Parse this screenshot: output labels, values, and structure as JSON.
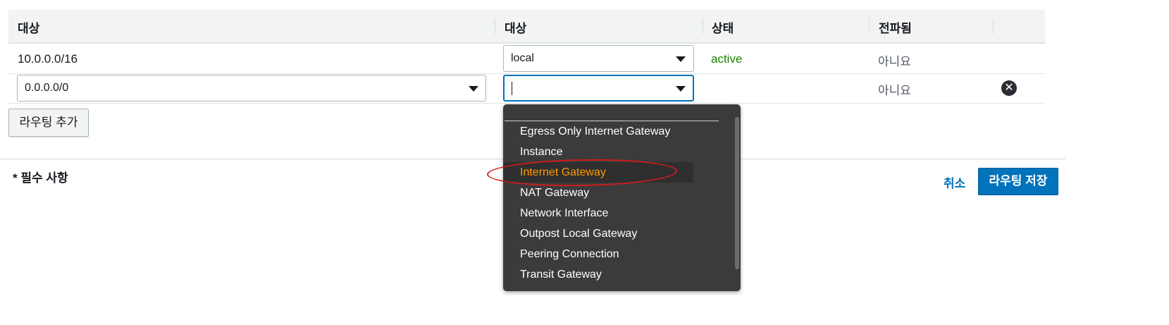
{
  "table": {
    "headers": [
      "대상",
      "대상",
      "상태",
      "전파됨"
    ],
    "rows": [
      {
        "destination": "10.0.0.0/16",
        "target": "local",
        "status": "active",
        "propagated": "아니요"
      },
      {
        "destination": "0.0.0.0/0",
        "target": "",
        "status": "",
        "propagated": "아니요"
      }
    ]
  },
  "actions": {
    "add_route": "라우팅 추가",
    "required_note": "* 필수 사항",
    "cancel": "취소",
    "save": "라우팅 저장"
  },
  "dropdown": {
    "highlighted": "Internet Gateway",
    "options": [
      "Egress Only Internet Gateway",
      "Instance",
      "Internet Gateway",
      "NAT Gateway",
      "Network Interface",
      "Outpost Local Gateway",
      "Peering Connection",
      "Transit Gateway"
    ]
  },
  "colors": {
    "accent": "#0073bb",
    "status_active": "#1d8102",
    "highlight": "#ff9900",
    "annotation": "#d31b1b"
  },
  "icons": {
    "remove": "x-circle-icon",
    "caret": "caret-down-icon"
  }
}
